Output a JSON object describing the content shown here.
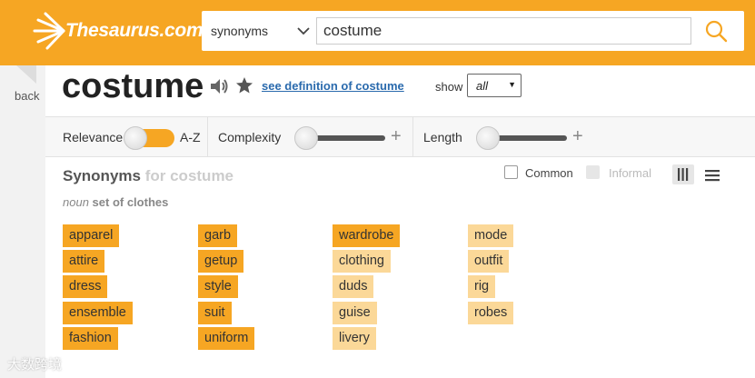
{
  "header": {
    "logo_text": "Thesaurus.com",
    "search_type": "synonyms",
    "search_value": "costume",
    "colors": {
      "brand": "#f6a623",
      "link": "#2a6aad"
    }
  },
  "nav": {
    "back_label": "back"
  },
  "word": {
    "title": "costume",
    "definition_link": "see definition of costume",
    "show_label": "show",
    "show_value": "all"
  },
  "filters": {
    "relevance_label": "Relevance",
    "az_label": "A-Z",
    "complexity_label": "Complexity",
    "length_label": "Length"
  },
  "synonyms": {
    "heading": "Synonyms",
    "heading_for": "for costume",
    "common_label": "Common",
    "informal_label": "Informal",
    "part_of_speech": "noun",
    "sense": "set of clothes",
    "columns": [
      [
        {
          "word": "apparel",
          "relevance": 3
        },
        {
          "word": "attire",
          "relevance": 3
        },
        {
          "word": "dress",
          "relevance": 3
        },
        {
          "word": "ensemble",
          "relevance": 3
        },
        {
          "word": "fashion",
          "relevance": 3
        }
      ],
      [
        {
          "word": "garb",
          "relevance": 3
        },
        {
          "word": "getup",
          "relevance": 3
        },
        {
          "word": "style",
          "relevance": 3
        },
        {
          "word": "suit",
          "relevance": 3
        },
        {
          "word": "uniform",
          "relevance": 3
        }
      ],
      [
        {
          "word": "wardrobe",
          "relevance": 3
        },
        {
          "word": "clothing",
          "relevance": 1
        },
        {
          "word": "duds",
          "relevance": 1
        },
        {
          "word": "guise",
          "relevance": 1
        },
        {
          "word": "livery",
          "relevance": 1
        }
      ],
      [
        {
          "word": "mode",
          "relevance": 1
        },
        {
          "word": "outfit",
          "relevance": 1
        },
        {
          "word": "rig",
          "relevance": 1
        },
        {
          "word": "robes",
          "relevance": 1
        }
      ]
    ]
  },
  "watermark": "大数跨境"
}
